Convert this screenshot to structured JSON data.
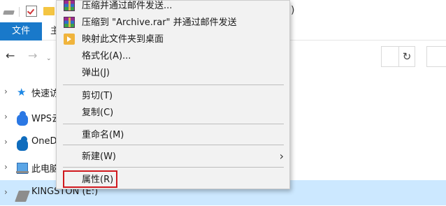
{
  "explorer": {
    "title_fragment": ")",
    "ribbon": {
      "file_tab": "文件",
      "home_tab": "主"
    },
    "nav_pane": {
      "items": [
        {
          "label": "快速访",
          "icon": "star-icon"
        },
        {
          "label": "WPS云",
          "icon": "wps-cloud-icon"
        },
        {
          "label": "OneD",
          "icon": "onedrive-cloud-icon"
        },
        {
          "label": "此电脑",
          "icon": "this-pc-icon"
        },
        {
          "label": "KINGSTON (E:)",
          "icon": "usb-drive-icon",
          "selected": true
        }
      ]
    },
    "toolbar": {
      "back": "←",
      "forward": "→",
      "dropdown": "⌄",
      "refresh": "↻"
    }
  },
  "context_menu": {
    "items": [
      {
        "label": "压缩并通过邮件发送...",
        "icon": "winrar-icon"
      },
      {
        "label": "压缩到 \"Archive.rar\" 并通过邮件发送",
        "icon": "winrar-icon"
      },
      {
        "label": "映射此文件夹到桌面",
        "icon": "map-folder-icon"
      },
      {
        "label": "格式化(A)..."
      },
      {
        "label": "弹出(J)"
      },
      {
        "label": "剪切(T)"
      },
      {
        "label": "复制(C)"
      },
      {
        "label": "重命名(M)"
      },
      {
        "label": "新建(W)",
        "submenu_arrow": "›"
      },
      {
        "label": "属性(R)",
        "highlighted": true
      }
    ]
  },
  "colors": {
    "accent": "#1979ca",
    "selection": "#cce8ff",
    "highlight_border": "#d0191e",
    "menu_bg": "#f2f2f2"
  }
}
